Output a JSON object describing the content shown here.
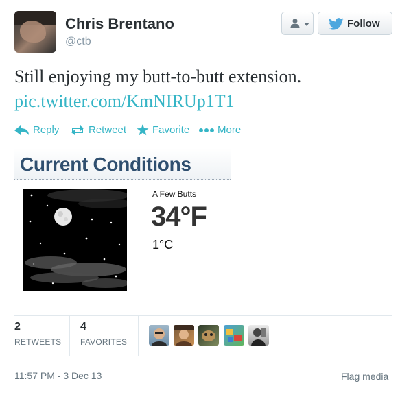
{
  "author": {
    "name": "Chris Brentano",
    "handle": "@ctb"
  },
  "header": {
    "follow_label": "Follow"
  },
  "tweet": {
    "text": "Still enjoying my butt-to-butt extension.",
    "link": "pic.twitter.com/KmNIRUp1T1"
  },
  "actions": {
    "reply": "Reply",
    "retweet": "Retweet",
    "favorite": "Favorite",
    "more": "More"
  },
  "weather": {
    "title": "Current Conditions",
    "description": "A Few Butts",
    "temp_f": "34°F",
    "temp_c": "1°C"
  },
  "stats": {
    "retweets_count": "2",
    "retweets_label": "RETWEETS",
    "favorites_count": "4",
    "favorites_label": "FAVORITES"
  },
  "footer": {
    "timestamp": "11:57 PM - 3 Dec 13",
    "flag_label": "Flag media"
  },
  "colors": {
    "link": "#35b5c6",
    "text": "#292f33",
    "muted": "#66757f",
    "weather_title": "#2f4f6f"
  },
  "icons": [
    "user-icon",
    "chevron-down-icon",
    "twitter-bird-icon",
    "reply-icon",
    "retweet-icon",
    "star-icon",
    "more-dots-icon"
  ]
}
